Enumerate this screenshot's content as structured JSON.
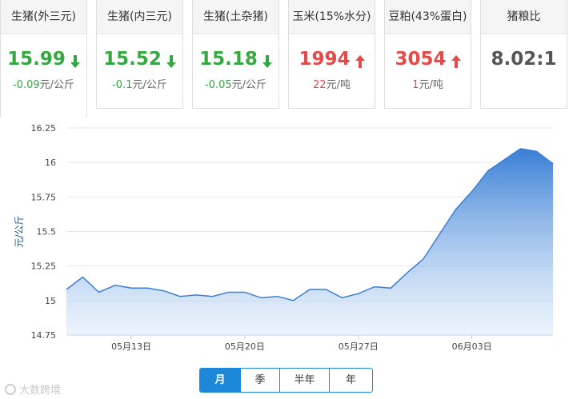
{
  "cards": [
    {
      "title": "生猪(外三元)",
      "price": "15.99",
      "direction": "down",
      "change_value": "-0.09",
      "change_unit": "元/公斤"
    },
    {
      "title": "生猪(内三元)",
      "price": "15.52",
      "direction": "down",
      "change_value": "-0.1",
      "change_unit": "元/公斤"
    },
    {
      "title": "生猪(土杂猪)",
      "price": "15.18",
      "direction": "down",
      "change_value": "-0.05",
      "change_unit": "元/公斤"
    },
    {
      "title": "玉米(15%水分)",
      "price": "1994",
      "direction": "up",
      "change_value": "22",
      "change_unit": "元/吨"
    },
    {
      "title": "豆粕(43%蛋白)",
      "price": "3054",
      "direction": "up",
      "change_value": "1",
      "change_unit": "元/吨"
    },
    {
      "title": "猪粮比",
      "price": "8.02:1",
      "direction": "none",
      "change_value": "",
      "change_unit": ""
    }
  ],
  "range_tabs": [
    {
      "label": "月",
      "selected": true
    },
    {
      "label": "季",
      "selected": false
    },
    {
      "label": "半年",
      "selected": false
    },
    {
      "label": "年",
      "selected": false
    }
  ],
  "watermark": "大数跨境",
  "colors": {
    "up": "#e44a4a",
    "down": "#36a842",
    "series": "#3a7fd5",
    "tab_accent": "#1e88d8"
  },
  "chart_data": {
    "type": "area",
    "ylabel": "元/公斤",
    "ylim": [
      14.75,
      16.25
    ],
    "yticks": [
      "14.75",
      "15",
      "15.25",
      "15.5",
      "15.75",
      "16",
      "16.25"
    ],
    "xtick_labels": [
      {
        "index": 4,
        "label": "05月13日"
      },
      {
        "index": 11,
        "label": "05月20日"
      },
      {
        "index": 18,
        "label": "05月27日"
      },
      {
        "index": 25,
        "label": "06月03日"
      }
    ],
    "grid": true,
    "series": [
      {
        "values": [
          15.08,
          15.17,
          15.06,
          15.11,
          15.09,
          15.09,
          15.07,
          15.03,
          15.04,
          15.03,
          15.06,
          15.06,
          15.02,
          15.03,
          15.0,
          15.08,
          15.08,
          15.02,
          15.05,
          15.1,
          15.09,
          15.2,
          15.3,
          15.48,
          15.66,
          15.79,
          15.94,
          16.02,
          16.1,
          16.08,
          15.99
        ]
      }
    ]
  }
}
